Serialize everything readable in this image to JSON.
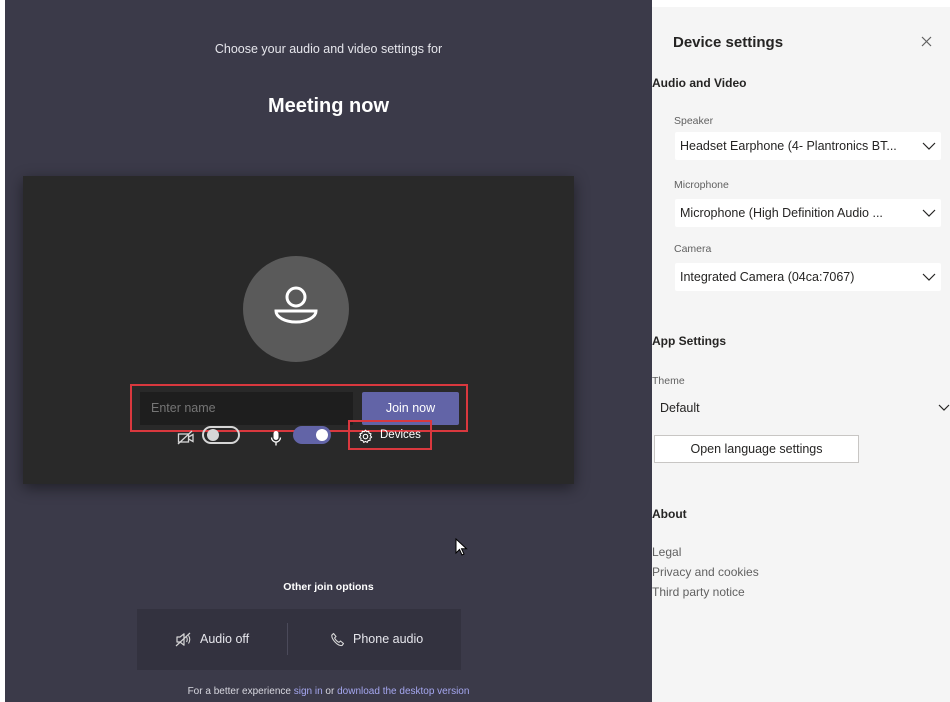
{
  "prejoin": {
    "choose_text": "Choose your audio and video settings for",
    "meeting_title": "Meeting now",
    "name_placeholder": "Enter name",
    "join_label": "Join now",
    "devices_label": "Devices",
    "other_options_label": "Other join options",
    "audio_off_label": "Audio off",
    "phone_audio_label": "Phone audio",
    "footer_prefix": "For a better experience ",
    "footer_signin": "sign in",
    "footer_or": " or ",
    "footer_download": "download the desktop version",
    "camera_toggle": "off",
    "mic_toggle": "on"
  },
  "device_settings": {
    "title": "Device settings",
    "audio_video_heading": "Audio and Video",
    "speaker_label": "Speaker",
    "speaker_value": "Headset Earphone (4- Plantronics BT...",
    "microphone_label": "Microphone",
    "microphone_value": "Microphone (High Definition Audio ...",
    "camera_label": "Camera",
    "camera_value": "Integrated Camera (04ca:7067)",
    "app_settings_heading": "App Settings",
    "theme_label": "Theme",
    "theme_value": "Default",
    "language_button": "Open language settings",
    "about_heading": "About",
    "about_links": [
      "Legal",
      "Privacy and cookies",
      "Third party notice"
    ]
  },
  "colors": {
    "accent": "#6264a7",
    "highlight": "#d9383e",
    "background": "#3b3a49",
    "panel": "#f5f5f5"
  }
}
